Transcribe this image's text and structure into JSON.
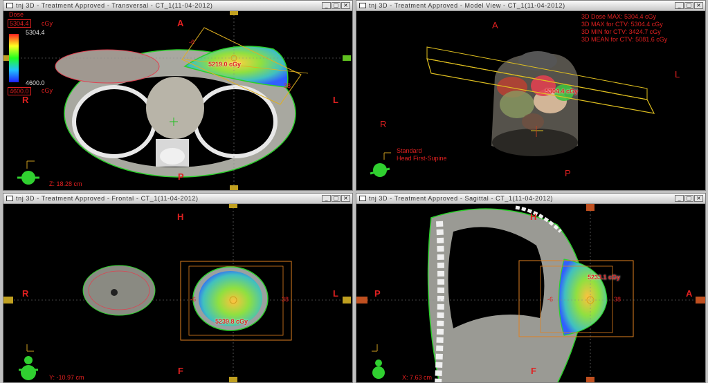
{
  "windows": {
    "transversal": {
      "title": "tnj 3D - Treatment Approved - Transversal - CT_1(11-04-2012)",
      "orient": {
        "top": "A",
        "bottom": "P",
        "left": "R",
        "right": "L"
      },
      "dose_label": "Dose",
      "dose_max": "5304.4",
      "dose_max_unit": "cGy",
      "scale_max": "5304.4",
      "scale_min": "4600.0",
      "dose_min": "4600.0",
      "dose_min_unit": "cGy",
      "point_dose": "5219.0 cGy",
      "slice": "Z: 18.28 cm",
      "beam_labels": [
        "-6",
        "38"
      ]
    },
    "model": {
      "title": "tnj 3D - Treatment Approved - Model View - CT_1(11-04-2012)",
      "orient": {
        "top": "A",
        "bottom": "P",
        "left": "R",
        "right": "L"
      },
      "stats": [
        "3D Dose MAX: 5304.4 cGy",
        "3D MAX for CTV: 5304.4 cGy",
        "3D MIN for CTV: 3424.7 cGy",
        "3D MEAN for CTV: 5081.6 cGy"
      ],
      "point_dose": "5304.4 cGy",
      "patient_position": [
        "Standard",
        "Head First-Supine"
      ]
    },
    "frontal": {
      "title": "tnj 3D - Treatment Approved - Frontal - CT_1(11-04-2012)",
      "orient": {
        "top": "H",
        "bottom": "F",
        "left": "R",
        "right": "L"
      },
      "point_dose": "5239.8 cGy",
      "slice": "Y: -10.97 cm",
      "beam_labels": [
        "-6",
        "38"
      ]
    },
    "sagittal": {
      "title": "tnj 3D - Treatment Approved - Sagittal - CT_1(11-04-2012)",
      "orient": {
        "top": "H",
        "bottom": "F",
        "left": "P",
        "right": "A"
      },
      "point_dose": "5233.1 cGy",
      "slice": "X: 7.63 cm",
      "beam_labels": [
        "-6",
        "38"
      ]
    }
  },
  "titlebar_buttons": {
    "min": "_",
    "max": "□",
    "close": "×"
  },
  "colors": {
    "label": "#e02020",
    "beam": "#f0a020",
    "contour": "#2cd02c",
    "crosshair": "#d0a020"
  }
}
